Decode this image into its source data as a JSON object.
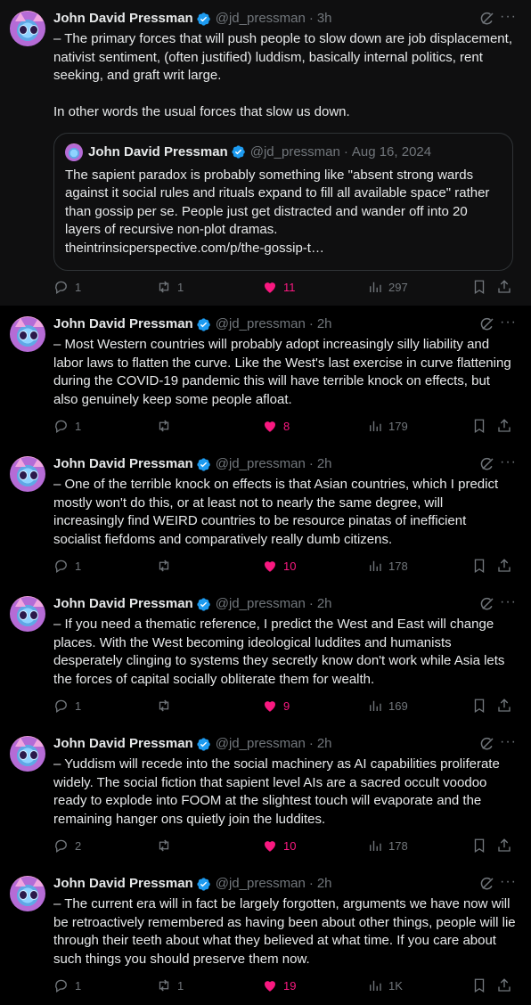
{
  "author": {
    "name": "John David Pressman",
    "handle": "@jd_pressman"
  },
  "colors": {
    "like": "#f91880",
    "muted": "#71767b",
    "verified": "#1d9bf0",
    "text": "#e7e9ea"
  },
  "tweets": [
    {
      "time": "3h",
      "text": "– The primary forces that will push people to slow down are job displacement, nativist sentiment, (often justified) luddism, basically internal politics, rent seeking, and graft writ large.\n\nIn other words the usual forces that slow us down.",
      "quote": {
        "name": "John David Pressman",
        "handle": "@jd_pressman",
        "date": "Aug 16, 2024",
        "text": "The sapient paradox is probably something like \"absent strong wards against it social rules and rituals expand to fill all available space\" rather than gossip per se. People just get distracted and wander off into 20 layers of recursive non-plot dramas.",
        "link": "theintrinsicperspective.com/p/the-gossip-t…"
      },
      "replies": "1",
      "retweets": "1",
      "likes": "11",
      "views": "297"
    },
    {
      "time": "2h",
      "text": "– Most Western countries will probably adopt increasingly silly liability and labor laws to flatten the curve. Like the West's last exercise in curve flattening during the COVID-19 pandemic this will have terrible knock on effects, but also genuinely keep some people afloat.",
      "replies": "1",
      "retweets": "",
      "likes": "8",
      "views": "179"
    },
    {
      "time": "2h",
      "text": "– One of the terrible knock on effects is that Asian countries, which I predict mostly won't do this, or at least not to nearly the same degree, will increasingly find WEIRD countries to be resource pinatas of inefficient socialist fiefdoms and comparatively really dumb citizens.",
      "replies": "1",
      "retweets": "",
      "likes": "10",
      "views": "178"
    },
    {
      "time": "2h",
      "text": "– If you need a thematic reference, I predict the West and East will change places. With the West becoming ideological luddites and humanists desperately clinging to systems they secretly know don't work while Asia lets the forces of capital socially obliterate them for wealth.",
      "replies": "1",
      "retweets": "",
      "likes": "9",
      "views": "169"
    },
    {
      "time": "2h",
      "text": "– Yuddism will recede into the social machinery as AI capabilities proliferate widely. The social fiction that sapient level AIs are a sacred occult voodoo ready to explode into FOOM at the slightest touch will evaporate and the remaining hanger ons quietly join the luddites.",
      "replies": "2",
      "retweets": "",
      "likes": "10",
      "views": "178"
    },
    {
      "time": "2h",
      "text": "– The current era will in fact be largely forgotten, arguments we have now will be retroactively remembered as having been about other things, people will lie through their teeth about what they believed at what time. If you care about such things you should preserve them now.",
      "replies": "1",
      "retweets": "1",
      "likes": "19",
      "views": "1K"
    }
  ]
}
